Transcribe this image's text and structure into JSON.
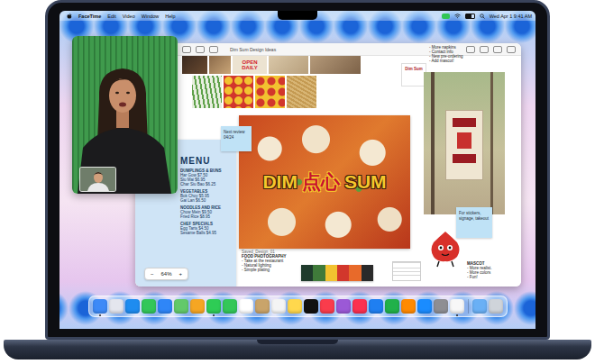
{
  "menubar": {
    "app": "FaceTime",
    "menus": [
      "Edit",
      "Video",
      "Window",
      "Help"
    ],
    "clock": "Wed Apr 1 9:41 AM"
  },
  "freeform": {
    "title": "Dim Sum Design Ideas",
    "todo": [
      "- More napkins",
      "- Contact info",
      "- New pre-ordering",
      "- Add mascot!"
    ],
    "open_daily": "OPEN DAILY",
    "card_label": "Dim Sum",
    "review_note": "Next review 04/24",
    "menu_card": {
      "title": "MENU",
      "sections": [
        {
          "heading": "DUMPLINGS & BUNS",
          "items": [
            "Har Gow $7.50",
            "Siu Mai $6.95",
            "Char Siu Bao $6.25"
          ]
        },
        {
          "heading": "VEGETABLES",
          "items": [
            "Bok Choy $5.95",
            "Gai Lan $6.50"
          ]
        },
        {
          "heading": "NOODLES AND RICE",
          "items": [
            "Chow Mein $9.50",
            "Fried Rice $8.95"
          ]
        },
        {
          "heading": "CHEF SPECIALS",
          "items": [
            "Egg Tarts $4.50",
            "Sesame Balls $4.95"
          ]
        }
      ]
    },
    "poster": {
      "left": "DIM",
      "middle": "点心",
      "right": "SUM"
    },
    "photo_notes": {
      "file": "Saved_Design_01",
      "heading": "FOOD PHOTOGRAPHY",
      "items": [
        "- Take at the restaurant",
        "- Natural lighting",
        "- Simple plating"
      ]
    },
    "swatches": [
      {
        "color": "#1f3b2c"
      },
      {
        "color": "#3f7a3a"
      },
      {
        "color": "#f2c230"
      },
      {
        "color": "#d2372c"
      },
      {
        "color": "#e86a2a"
      },
      {
        "color": "#2a2a2a"
      }
    ],
    "signage_note": "For stickers, signage, takeout",
    "mascot_notes": {
      "heading": "MASCOT",
      "items": [
        "- More realist.",
        "- More colors",
        "- Fun!"
      ]
    },
    "zoom": {
      "out": "−",
      "level": "64%",
      "in": "+"
    }
  },
  "dock": [
    {
      "color": "#3d8af7",
      "running": true
    },
    {
      "color": "#e4e6ee",
      "running": false
    },
    {
      "color": "#1e8cf0",
      "running": false
    },
    {
      "color": "#33c759",
      "running": false
    },
    {
      "color": "#2f86f7",
      "running": false
    },
    {
      "color": "#63c96a",
      "running": false
    },
    {
      "color": "#f5a623",
      "running": false
    },
    {
      "color": "#2ecc55",
      "running": true
    },
    {
      "color": "#34c759",
      "running": false
    },
    {
      "color": "#ffffff",
      "running": false
    },
    {
      "color": "#c9a46a",
      "running": false
    },
    {
      "color": "#f4f4f4",
      "running": false
    },
    {
      "color": "#ffd84d",
      "running": false
    },
    {
      "color": "#111111",
      "running": false
    },
    {
      "color": "#fa3c4c",
      "running": false
    },
    {
      "color": "#9b59d6",
      "running": false
    },
    {
      "color": "#fb3050",
      "running": false
    },
    {
      "color": "#1f7ff1",
      "running": false
    },
    {
      "color": "#21b14a",
      "running": false
    },
    {
      "color": "#ff8a00",
      "running": false
    },
    {
      "color": "#1a8cff",
      "running": false
    },
    {
      "color": "#8e8e93",
      "running": false
    },
    {
      "color": "#f7f7f7",
      "running": true
    },
    {
      "color": "#6ab0f5",
      "running": false
    },
    {
      "color": "#cfd4da",
      "running": false
    }
  ]
}
